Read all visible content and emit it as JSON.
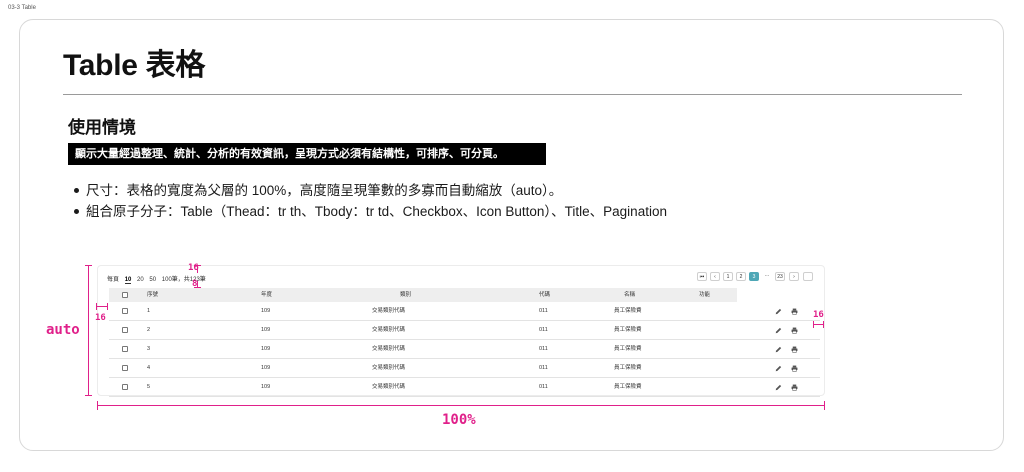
{
  "frame_label": "03-3 Table",
  "title": "Table 表格",
  "section": "使用情境",
  "banner": "顯示大量經過整理、統計、分析的有效資訊，呈現方式必須有結構性，可排序、可分頁。",
  "bullets": [
    "尺寸：表格的寬度為父層的 100%，高度隨呈現筆數的多寡而自動縮放（auto）。",
    "組合原子分子：Table（Thead：tr th、Tbody：tr td、Checkbox、Icon Button）、Title、Pagination"
  ],
  "page_size": {
    "prefix": "每頁",
    "options": [
      "10",
      "20",
      "50",
      "100"
    ],
    "selected": "10",
    "suffix": "筆，共123筆"
  },
  "pagination": {
    "first": "⏮",
    "prev": "‹",
    "pages": [
      "1",
      "2",
      "3"
    ],
    "active": "3",
    "ellipsis": "···",
    "last_page": "23",
    "next": "›"
  },
  "table": {
    "headers": [
      "序號",
      "年度",
      "類別",
      "代碼",
      "名稱",
      "功能"
    ],
    "rows": [
      [
        "1",
        "109",
        "交易類別代碼",
        "011",
        "員工保險費"
      ],
      [
        "2",
        "109",
        "交易類別代碼",
        "011",
        "員工保險費"
      ],
      [
        "3",
        "109",
        "交易類別代碼",
        "011",
        "員工保險費"
      ],
      [
        "4",
        "109",
        "交易類別代碼",
        "011",
        "員工保險費"
      ],
      [
        "5",
        "109",
        "交易類別代碼",
        "011",
        "員工保險費"
      ]
    ],
    "actions": [
      "edit-icon",
      "print-icon"
    ]
  },
  "annotations": {
    "top_gap": "16",
    "inner_gap": "8",
    "left_pad": "16",
    "right_pad": "16",
    "height": "auto",
    "width": "100%"
  },
  "colors": {
    "annotation": "#e0208a",
    "active_page": "#4ea7b6",
    "banner": "#000000"
  }
}
